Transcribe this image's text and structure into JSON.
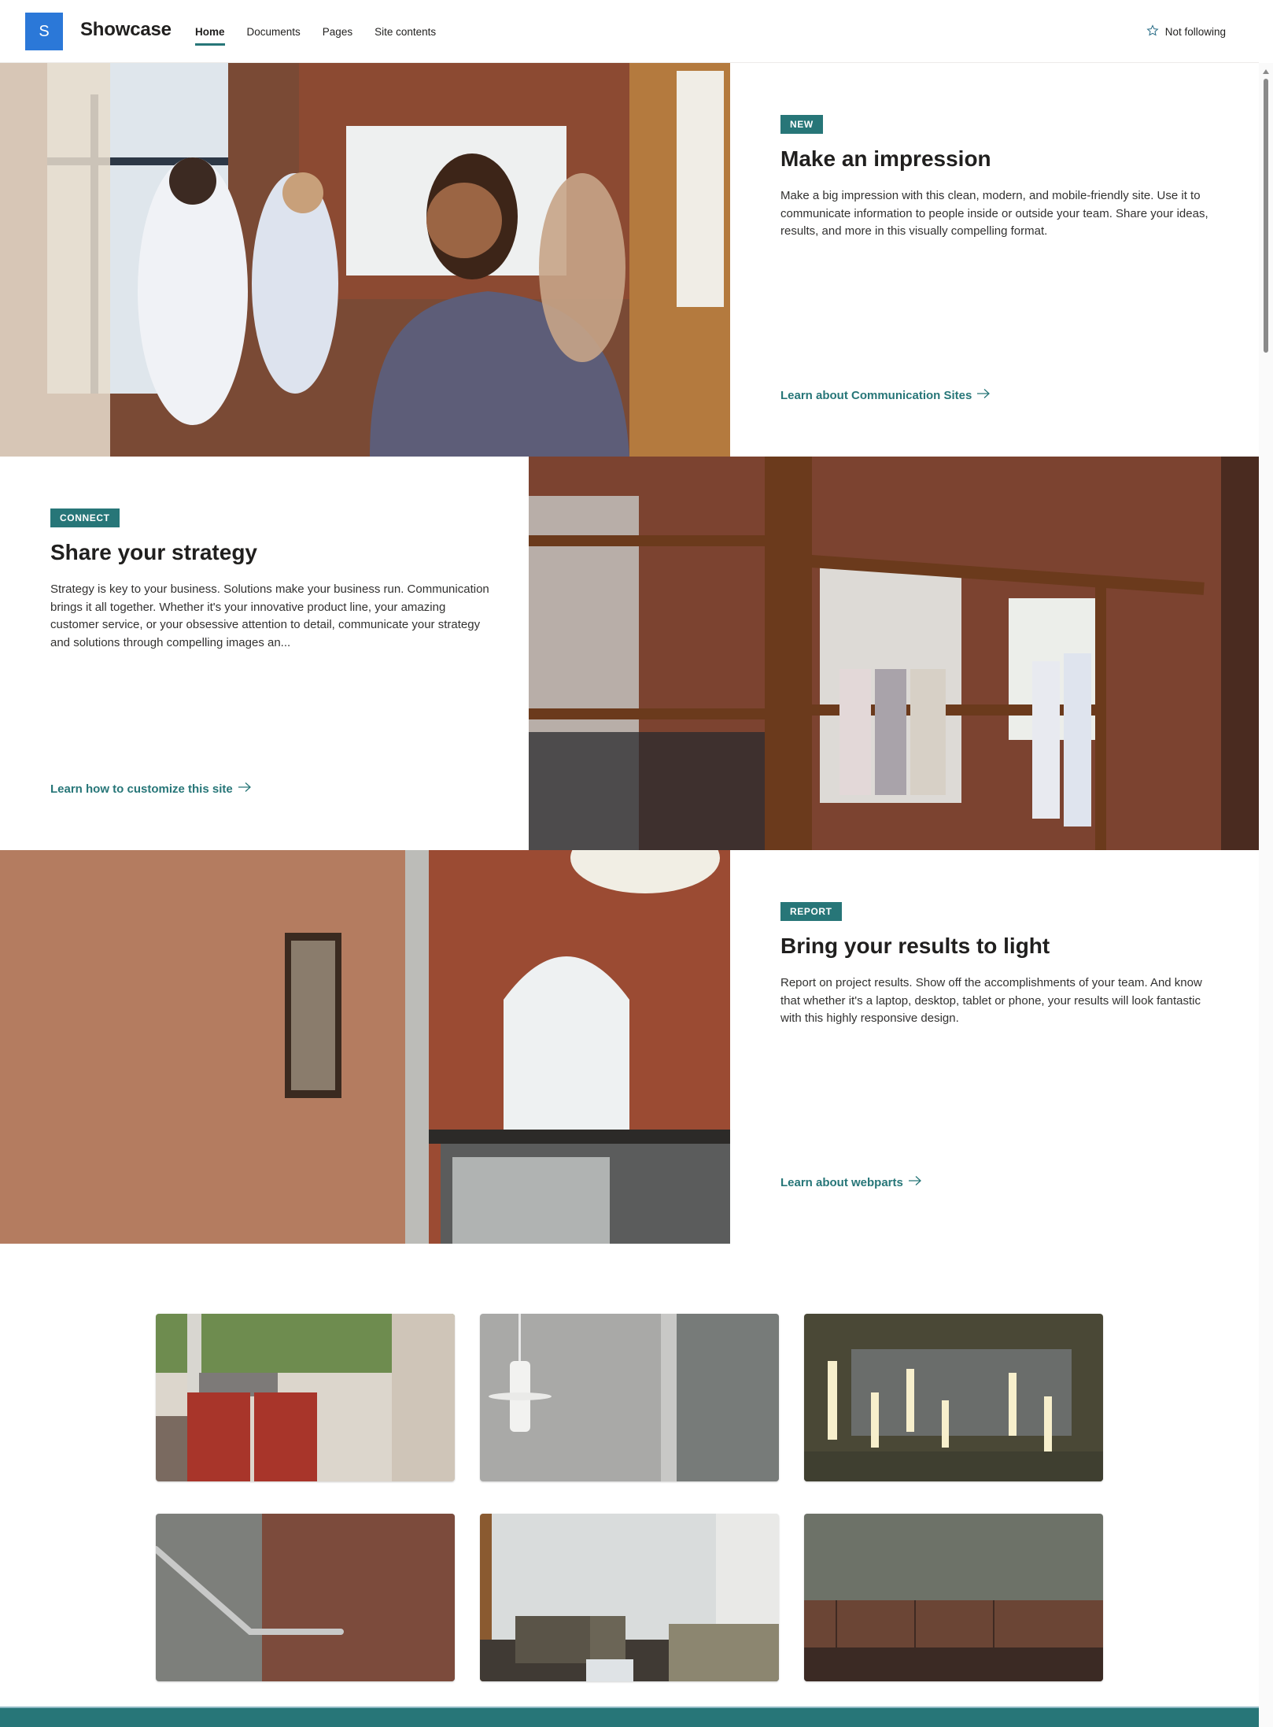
{
  "header": {
    "logo_letter": "S",
    "site_title": "Showcase",
    "nav": [
      {
        "label": "Home",
        "active": true
      },
      {
        "label": "Documents",
        "active": false
      },
      {
        "label": "Pages",
        "active": false
      },
      {
        "label": "Site contents",
        "active": false
      }
    ],
    "follow_label": "Not following",
    "follow_icon": "star-outline-icon"
  },
  "sections": [
    {
      "badge": "NEW",
      "title": "Make an impression",
      "description": "Make a big impression with this clean, modern, and mobile-friendly site. Use it to communicate information to people inside or outside your team. Share your ideas, results, and more in this visually compelling format.",
      "link_label": "Learn about Communication Sites",
      "image_alt": "Team meeting in brick-walled office"
    },
    {
      "badge": "CONNECT",
      "title": "Share your strategy",
      "description": "Strategy is key to your business. Solutions make your business run. Communication brings it all together. Whether it's your innovative product line, your amazing customer service, or your obsessive attention to detail, communicate your strategy and solutions through compelling images an...",
      "link_label": "Learn how to customize this site",
      "image_alt": "People meeting behind glass office partition"
    },
    {
      "badge": "REPORT",
      "title": "Bring your results to light",
      "description": "Report on project results. Show off the accomplishments of your team. And know that whether it's a laptop, desktop, tablet or phone, your results will look fantastic with this highly responsive design.",
      "link_label": "Learn about webparts",
      "image_alt": "Brick lobby with arched window"
    }
  ],
  "gallery": [
    {
      "alt": "Red lounge chairs by window"
    },
    {
      "alt": "Pendant lamp against grey wall"
    },
    {
      "alt": "Hanging cylinder lights"
    },
    {
      "alt": "Steel handrail on marble wall"
    },
    {
      "alt": "Lobby seating area"
    },
    {
      "alt": "Row of brown bench seats"
    }
  ],
  "colors": {
    "accent": "#277678",
    "logo_bg": "#2b78d8",
    "text": "#201f1e"
  }
}
